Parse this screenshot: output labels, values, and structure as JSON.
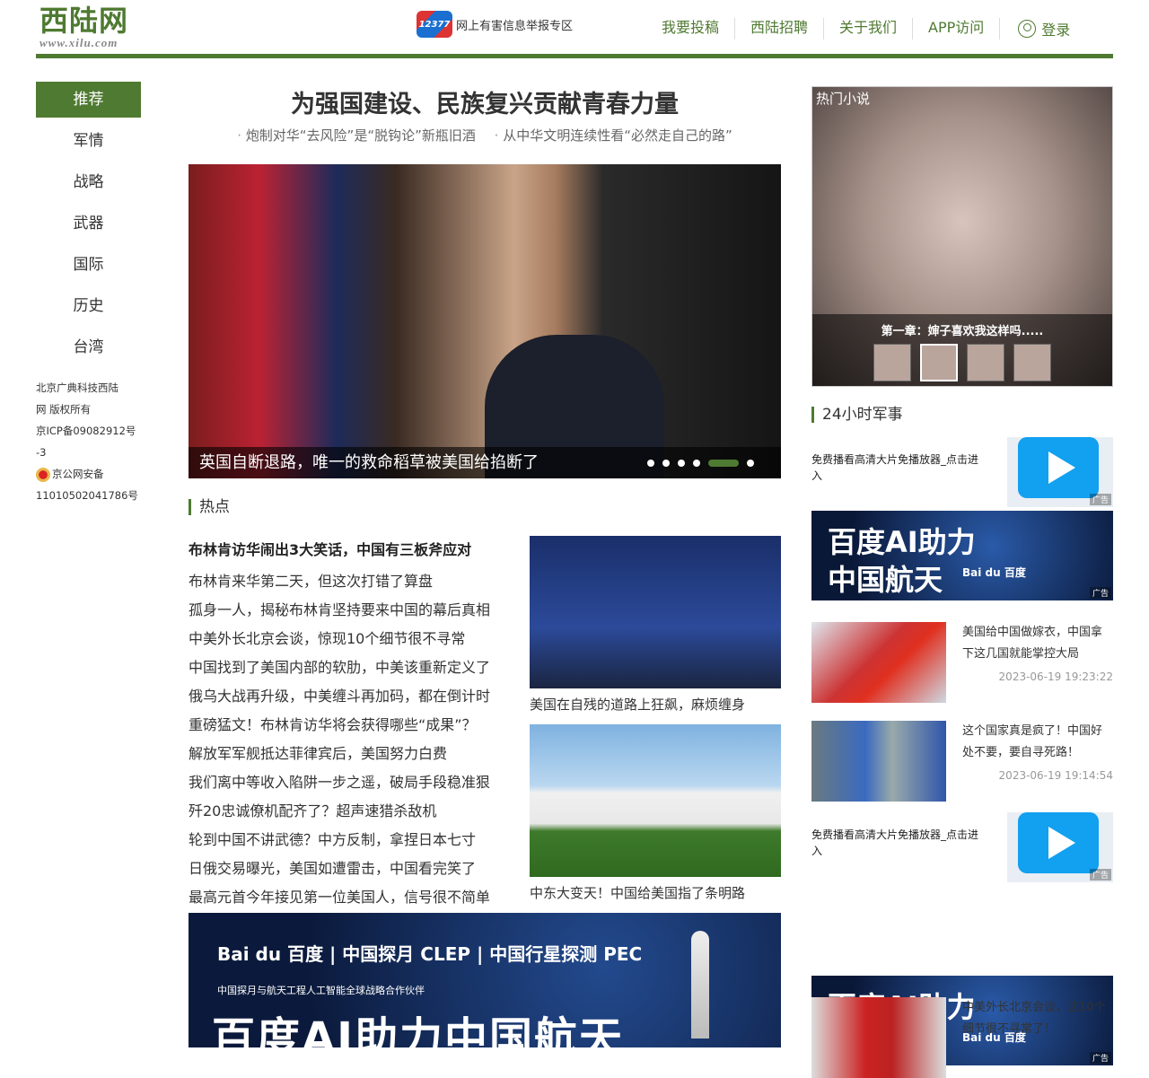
{
  "header": {
    "logo_cn": "西陆网",
    "logo_en": "www.xilu.com",
    "report_badge": "12377",
    "report_label": "网上有害信息举报专区",
    "nav": [
      "我要投稿",
      "西陆招聘",
      "关于我们",
      "APP访问"
    ],
    "login": "登录"
  },
  "sidebar": {
    "items": [
      "推荐",
      "军情",
      "战略",
      "武器",
      "国际",
      "历史",
      "台湾"
    ],
    "copyright": [
      "北京广典科技西陆",
      "网 版权所有",
      "京ICP备09082912号",
      "-3"
    ],
    "police": "京公网安备",
    "police_no": "11010502041786号"
  },
  "main": {
    "headline": "为强国建设、民族复兴贡献青春力量",
    "subheads": [
      "炮制对华“去风险”是“脱钩论”新瓶旧酒",
      "从中华文明连续性看“必然走自己的路”"
    ],
    "hero_caption": "英国自断退路，唯一的救命稻草被美国给掐断了",
    "hero_slides": 6,
    "hero_active": 5,
    "hot_section": "热点",
    "hot_title": "布林肯访华闹出3大笑话，中国有三板斧应对",
    "hot_list": [
      "布林肯来华第二天，但这次打错了算盘",
      "孤身一人，揭秘布林肯坚持要来中国的幕后真相",
      "中美外长北京会谈，惊现10个细节很不寻常",
      "中国找到了美国内部的软肋，中美该重新定义了",
      "俄乌大战再升级，中美缠斗再加码，都在倒计时",
      "重磅猛文！布林肯访华将会获得哪些“成果”？",
      "解放军军舰抵达菲律宾后，美国努力白费",
      "我们离中等收入陷阱一步之遥，破局手段稳准狠",
      "歼20忠诚僚机配齐了？超声速猎杀敌机",
      "轮到中国不讲武德？中方反制，拿捏日本七寸",
      "日俄交易曝光，美国如遭雷击，中国看完笑了",
      "最高元首今年接见第一位美国人，信号很不简单"
    ],
    "pic1_caption": "美国在自残的道路上狂飙，麻烦缠身",
    "pic2_caption": "中东大变天！中国给美国指了条明路",
    "ad": {
      "brand": "Bai du 百度  |  中国探月 CLEP  |  中国行星探测 PEC",
      "line": "中国探月与航天工程人工智能全球战略合作伙伴",
      "big": "百度AI助力中国航天"
    }
  },
  "right": {
    "novel_label": "热门小说",
    "novel_title": "第一章：婶子喜欢我这样吗.....",
    "ad_small": "广告",
    "section": "24小时军事",
    "player_ad": "免费播看高清大片免播放器_点击进入",
    "bd_ad": {
      "l1": "百度AI助力",
      "l2": "中国航天",
      "brand": "Bai du 百度"
    },
    "news": [
      {
        "title": "美国给中国做嫁衣，中国拿下这几国就能掌控大局",
        "date": "2023-06-19 19:23:22"
      },
      {
        "title": "这个国家真是疯了！中国好处不要，要自寻死路！",
        "date": "2023-06-19 19:14:54"
      },
      {
        "title": "中美外长北京会谈，这10个细节很不寻常了！",
        "date": ""
      }
    ]
  }
}
